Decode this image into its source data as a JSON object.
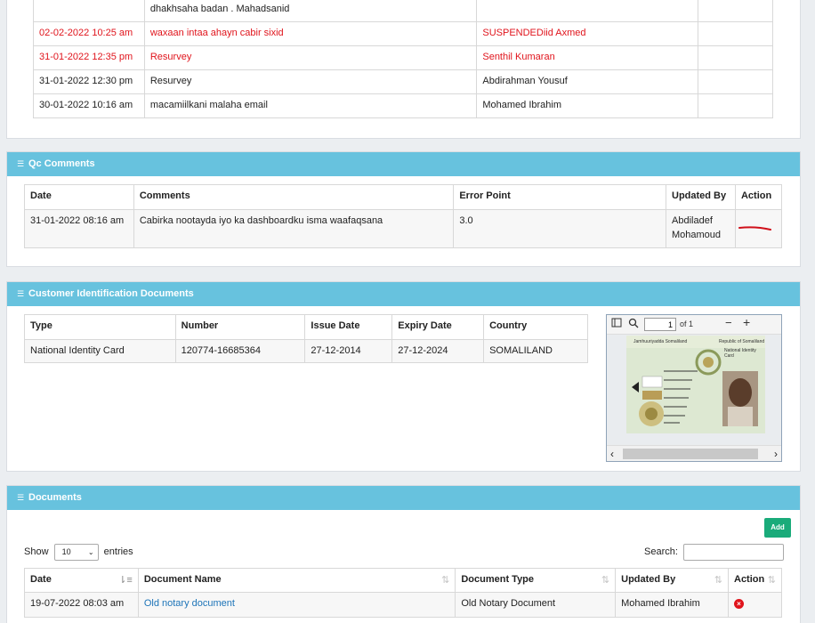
{
  "history": {
    "rows": [
      {
        "date": "",
        "comment": "dhakhsaha badan . Mahadsanid",
        "user": "",
        "red": false
      },
      {
        "date": "02-02-2022 10:25 am",
        "comment": "waxaan intaa ahayn cabir sixid",
        "user": "SUSPENDEDiid Axmed",
        "red": true
      },
      {
        "date": "31-01-2022 12:35 pm",
        "comment": "Resurvey",
        "user": "Senthil Kumaran",
        "red": true
      },
      {
        "date": "31-01-2022 12:30 pm",
        "comment": "Resurvey",
        "user": "Abdirahman Yousuf",
        "red": false
      },
      {
        "date": "30-01-2022 10:16 am",
        "comment": "macamiilkani malaha email",
        "user": "Mohamed Ibrahim",
        "red": false
      }
    ]
  },
  "qc": {
    "title": "Qc Comments",
    "headers": {
      "date": "Date",
      "comments": "Comments",
      "error": "Error Point",
      "updated": "Updated By",
      "action": "Action"
    },
    "row": {
      "date": "31-01-2022 08:16 am",
      "comments": "Cabirka nootayda iyo ka dashboardku isma waafaqsana",
      "error": "3.0",
      "updated1": "Abdiladef",
      "updated2": "Mohamoud"
    }
  },
  "cid": {
    "title": "Customer Identification Documents",
    "headers": {
      "type": "Type",
      "number": "Number",
      "issue": "Issue Date",
      "expiry": "Expiry Date",
      "country": "Country"
    },
    "row": {
      "type": "National Identity Card",
      "number": "120774-16685364",
      "issue": "27-12-2014",
      "expiry": "27-12-2024",
      "country": "SOMALILAND"
    },
    "viewer": {
      "page": "1",
      "of": "of 1",
      "card_title": "Jamhuuriyadda Somaliland",
      "card_title_en": "Republic of Somaliland",
      "card_sub": "National Identity Card"
    }
  },
  "docs": {
    "title": "Documents",
    "add_label": "Add",
    "show_label": "Show",
    "entries_value": "10",
    "entries_label": "entries",
    "search_label": "Search:",
    "headers": {
      "date": "Date",
      "name": "Document Name",
      "type": "Document Type",
      "updated": "Updated By",
      "action": "Action"
    },
    "row": {
      "date": "19-07-2022 08:03 am",
      "name": "Old notary document",
      "type": "Old Notary Document",
      "updated": "Mohamed Ibrahim"
    }
  },
  "colors": {
    "header": "#67c2de",
    "danger": "#e0141c",
    "add": "#1aab7a"
  }
}
